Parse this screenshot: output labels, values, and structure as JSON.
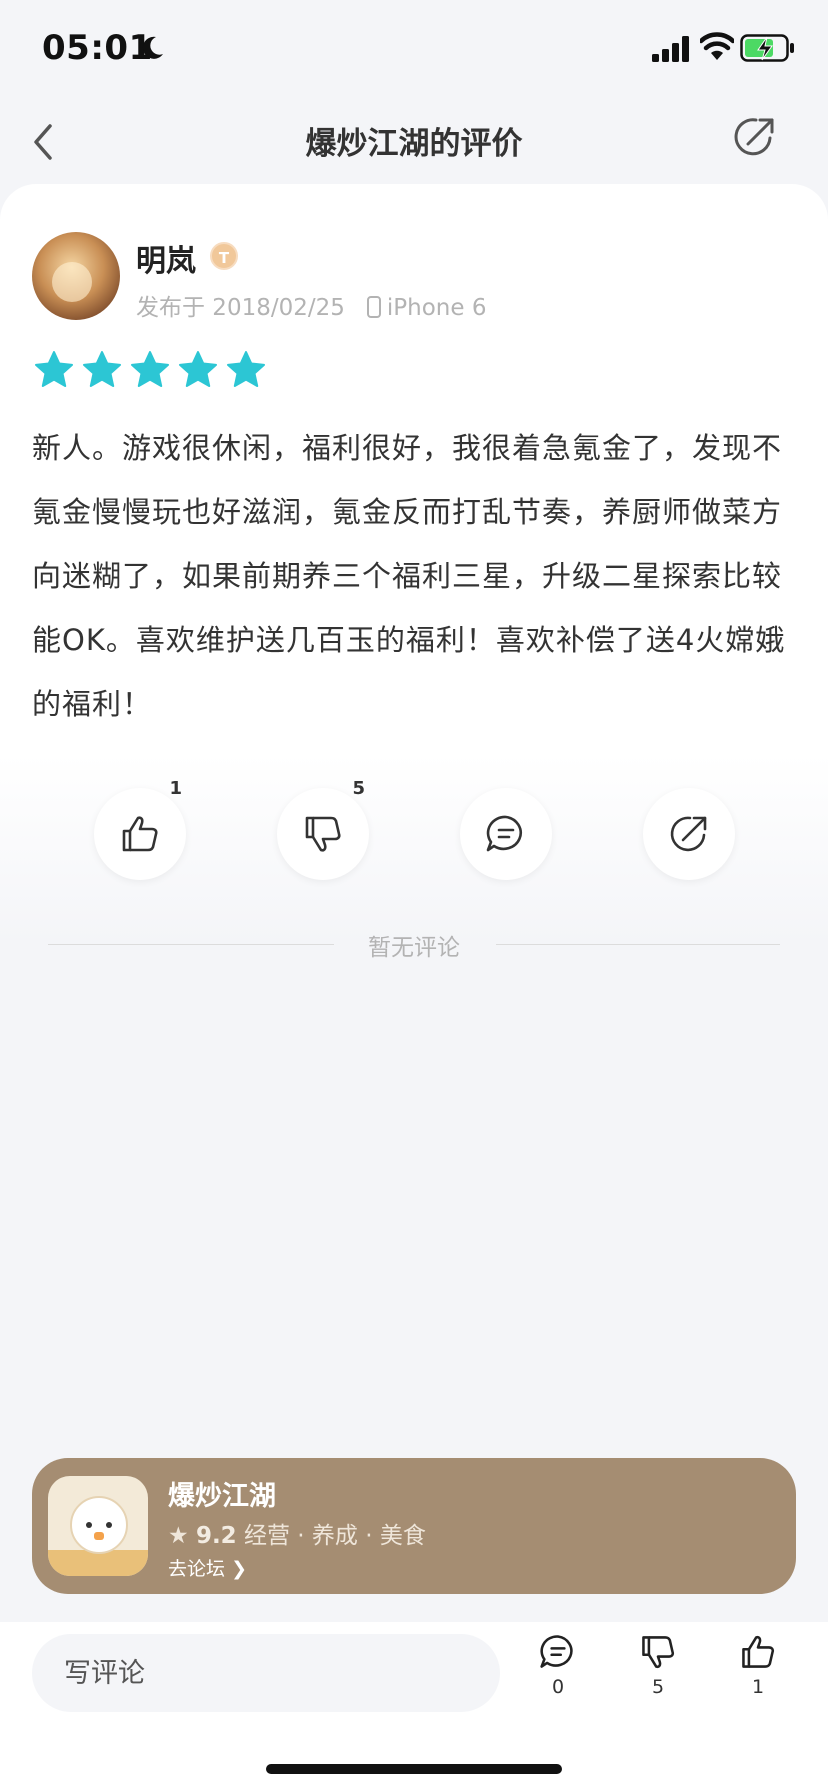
{
  "status_bar": {
    "time": "05:01"
  },
  "header": {
    "title": "爆炒江湖的评价"
  },
  "review": {
    "user_name": "明岚",
    "level_badge": "T",
    "posted": "发布于 2018/02/25",
    "device": "iPhone 6",
    "rating_stars": 5,
    "star_color": "#2cc6d4",
    "text": "新人。游戏很休闲，福利很好，我很着急氪金了，发现不氪金慢慢玩也好滋润，氪金反而打乱节奏，养厨师做菜方向迷糊了，如果前期养三个福利三星，升级二星探索比较能OK。喜欢维护送几百玉的福利！喜欢补偿了送4火嫦娥的福利！",
    "actions": {
      "like_count": "1",
      "dislike_count": "5"
    }
  },
  "comments": {
    "empty_text": "暂无评论"
  },
  "game_banner": {
    "title": "爆炒江湖",
    "score": "9.2",
    "tags": "经营 · 养成 · 美食",
    "forum_link": "去论坛",
    "background": "#a58d72"
  },
  "bottom_bar": {
    "input_placeholder": "写评论",
    "comment_count": "0",
    "dislike_count": "5",
    "like_count": "1"
  }
}
